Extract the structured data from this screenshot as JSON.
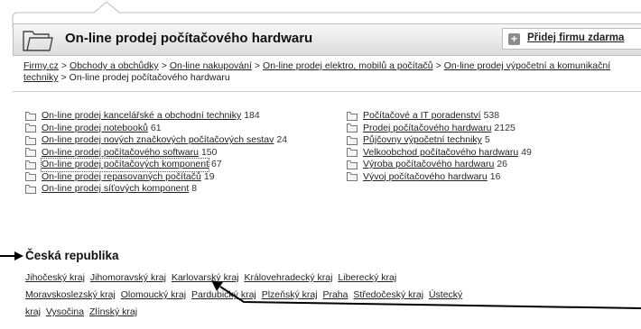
{
  "header": {
    "title": "On-line prodej počítačového hardwaru",
    "add_button": "Přidej firmu zdarma"
  },
  "breadcrumb": [
    "Firmy.cz",
    "Obchody a obchůdky",
    "On-line nakupování",
    "On-line prodej elektro, mobilů a počítačů",
    "On-line prodej výpočetní a komunikační techniky",
    "On-line prodej počítačového hardwaru"
  ],
  "breadcrumb_separator": ">",
  "categories_left": [
    {
      "label": "On-line prodej kancelářské a obchodní techniky",
      "count": "184"
    },
    {
      "label": "On-line prodej notebooků",
      "count": "61"
    },
    {
      "label": "On-line prodej nových značkových počítačových sestav",
      "count": "24"
    },
    {
      "label": "On-line prodej počítačového softwaru",
      "count": "150"
    },
    {
      "label": "On-line prodej počítačových komponent",
      "count": "67"
    },
    {
      "label": "On-line prodej repasovaných počítačů",
      "count": "19"
    },
    {
      "label": "On-line prodej síťových komponent",
      "count": "8"
    }
  ],
  "categories_right": [
    {
      "label": "Počítačové a IT poradenství",
      "count": "538"
    },
    {
      "label": "Prodej počítačového hardwaru",
      "count": "2125"
    },
    {
      "label": "Půjčovny výpočetní techniky",
      "count": "5"
    },
    {
      "label": "Velkoobchod počítačového hardwaru",
      "count": "49"
    },
    {
      "label": "Výroba počítačového hardwaru",
      "count": "26"
    },
    {
      "label": "Vývoj počítačového hardwaru",
      "count": "16"
    }
  ],
  "region": {
    "title": "Česká republika",
    "kraje": [
      "Jihočeský kraj",
      "Jihomoravský kraj",
      "Karlovarský kraj",
      "Královehradecký kraj",
      "Liberecký kraj",
      "Moravskoslezský kraj",
      "Olomoucký kraj",
      "Pardubický kraj",
      "Plzeňský kraj",
      "Praha",
      "Středočeský kraj",
      "Ústecký",
      "kraj",
      "Vysočina",
      "Zlínský kraj"
    ]
  },
  "icons": {
    "folder": "folder-icon",
    "add": "plus-icon",
    "pointer_arrow": "arrow-icon"
  },
  "colors": {
    "header_top": "#f7f7f7",
    "header_bottom": "#dcdcdc",
    "border": "#bdbdbd",
    "text": "#222222"
  }
}
